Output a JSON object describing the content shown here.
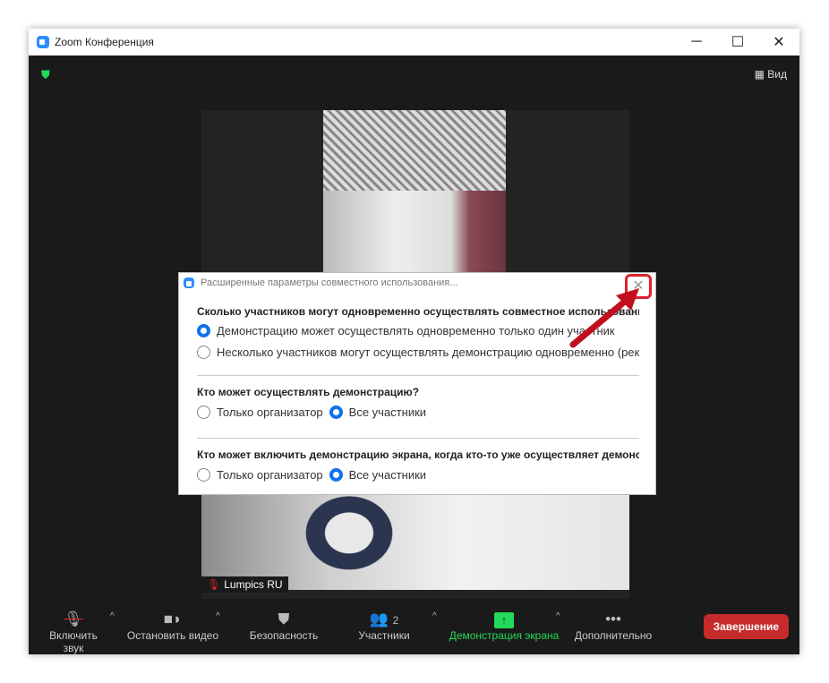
{
  "window": {
    "title": "Zoom Конференция",
    "minimize": "─",
    "maximize": "☐",
    "close": "✕"
  },
  "header": {
    "view_label": "Вид",
    "view_icon": "grid-icon",
    "security_icon": "shield-check-icon"
  },
  "video": {
    "participant_name": "Lumpics RU"
  },
  "toolbar": {
    "unmute": "Включить звук",
    "stop_video": "Остановить видео",
    "security": "Безопасность",
    "participants": "Участники",
    "participants_count": "2",
    "share_screen": "Демонстрация экрана",
    "more": "Дополнительно",
    "end": "Завершение",
    "caret": "^"
  },
  "dialog": {
    "title": "Расширенные параметры совместного использования...",
    "close": "✕",
    "q1": "Сколько участников могут одновременно осуществлять совместное использование?",
    "q1_options": [
      "Демонстрацию может осуществлять одновременно только один участник",
      "Несколько участников могут осуществлять демонстрацию одновременно (рекомендуется)"
    ],
    "q1_selected": 0,
    "q2": "Кто может осуществлять демонстрацию?",
    "q2_options": [
      "Только организатор",
      "Все участники"
    ],
    "q2_selected": 1,
    "q3": "Кто может включить демонстрацию экрана, когда кто-то уже осуществляет демонстрацию?",
    "q3_options": [
      "Только организатор",
      "Все участники"
    ],
    "q3_selected": 1
  },
  "colors": {
    "accent": "#0e72ed",
    "green": "#23d959",
    "end": "#c62a2a",
    "annotation": "#e0202a"
  }
}
